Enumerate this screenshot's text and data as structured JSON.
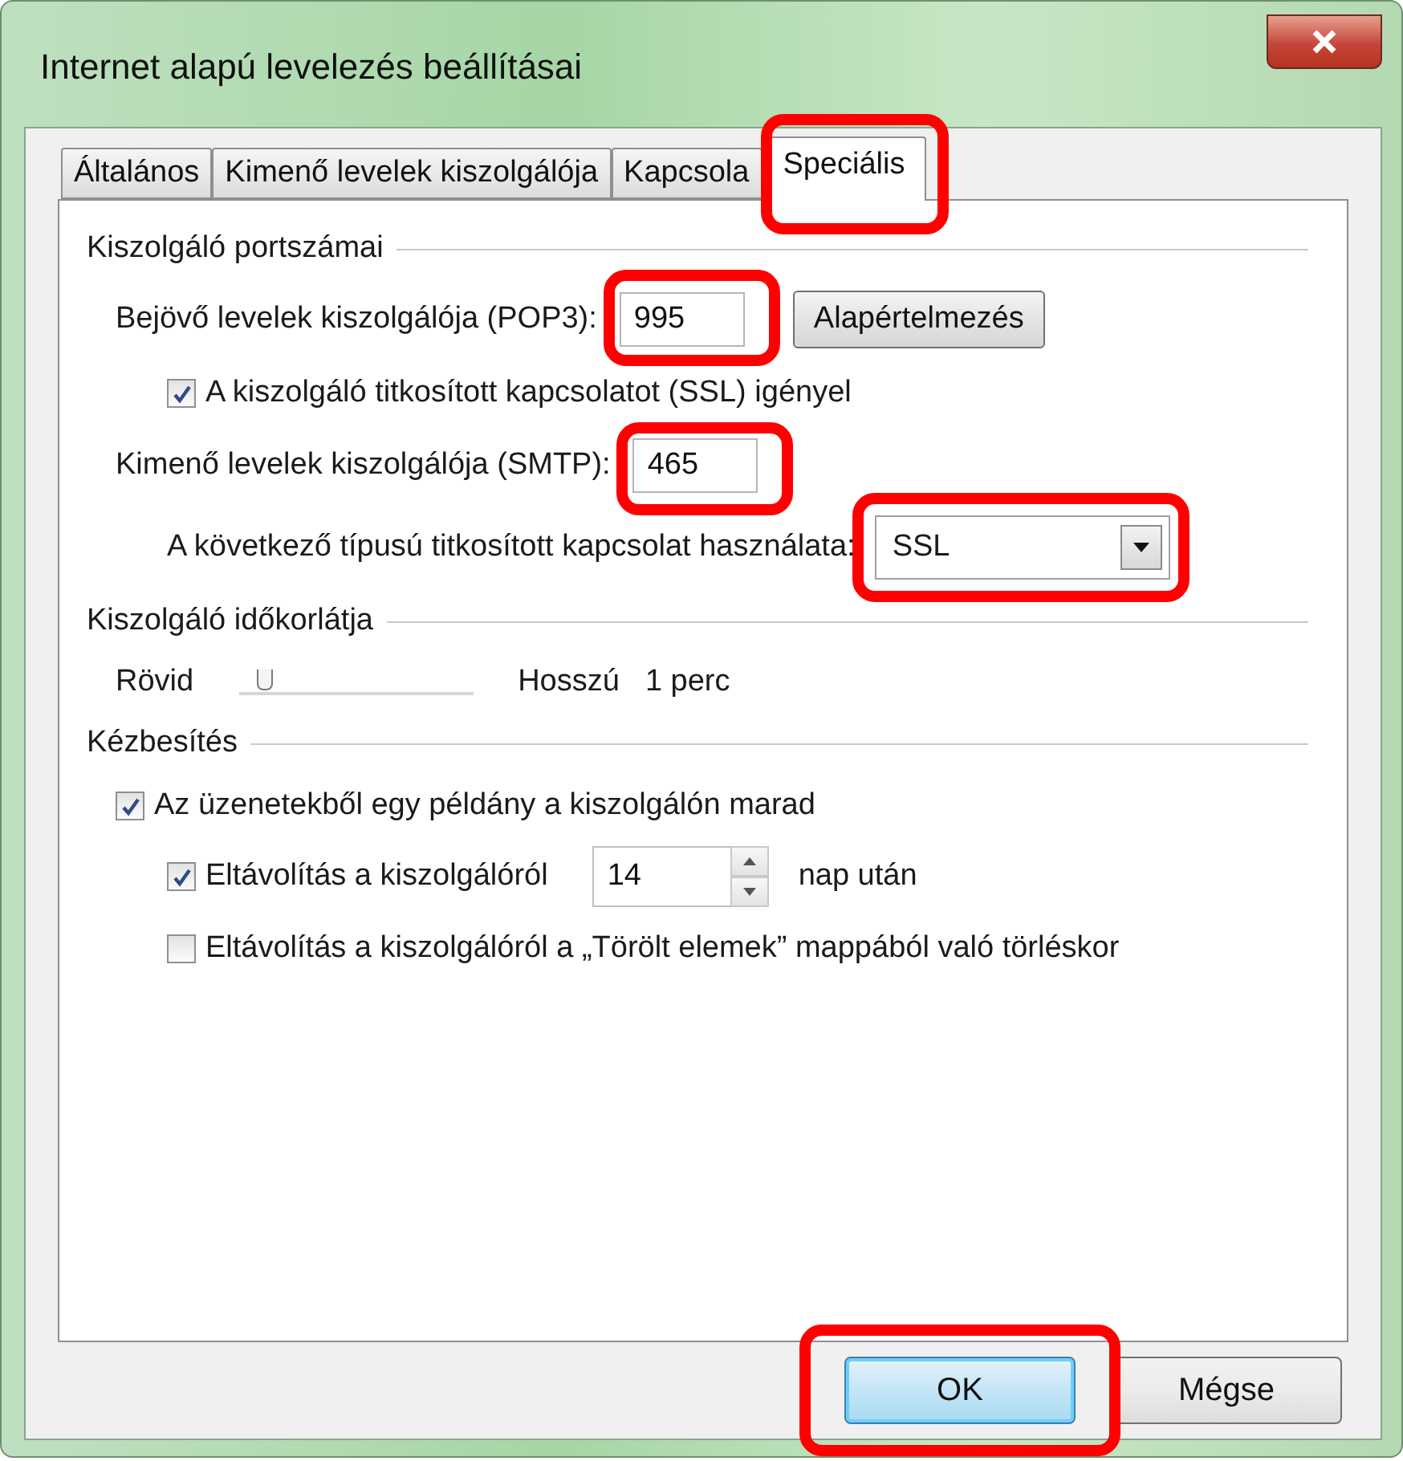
{
  "window": {
    "title": "Internet alapú levelezés beállításai"
  },
  "tabs": [
    {
      "label": "Általános",
      "selected": false,
      "highlighted": false
    },
    {
      "label": "Kimenő levelek kiszolgálója",
      "selected": false,
      "highlighted": false
    },
    {
      "label": "Kapcsola",
      "selected": false,
      "highlighted": false
    },
    {
      "label": "Speciális",
      "selected": true,
      "highlighted": true
    }
  ],
  "ports": {
    "title": "Kiszolgáló portszámai",
    "incoming": {
      "label": "Bejövő levelek kiszolgálója (POP3):",
      "value": "995",
      "highlighted": true,
      "default_button": "Alapértelmezés"
    },
    "ssl_required": {
      "label": "A kiszolgáló titkosított kapcsolatot (SSL) igényel",
      "checked": true
    },
    "outgoing": {
      "label": "Kimenő levelek kiszolgálója (SMTP):",
      "value": "465",
      "highlighted": true
    },
    "encryption": {
      "label": "A következő típusú titkosított kapcsolat használata:",
      "value": "SSL",
      "highlighted": true
    }
  },
  "timeout": {
    "title": "Kiszolgáló időkorlátja",
    "min_label": "Rövid",
    "max_label": "Hosszú",
    "level": 0.08,
    "reading": "1 perc"
  },
  "delivery": {
    "title": "Kézbesítés",
    "leave_copy": {
      "label": "Az üzenetekből egy példány a kiszolgálón marad",
      "checked": true
    },
    "remove_after": {
      "label": "Eltávolítás a kiszolgálóról",
      "checked": true,
      "value": "14",
      "unit": "nap után"
    },
    "remove_on_delete": {
      "label": "Eltávolítás a kiszolgálóról a „Törölt elemek” mappából való törléskor",
      "checked": false
    }
  },
  "buttons": [
    {
      "label": "OK",
      "default": true,
      "highlighted": true
    },
    {
      "label": "Mégse",
      "default": false,
      "highlighted": false
    }
  ]
}
